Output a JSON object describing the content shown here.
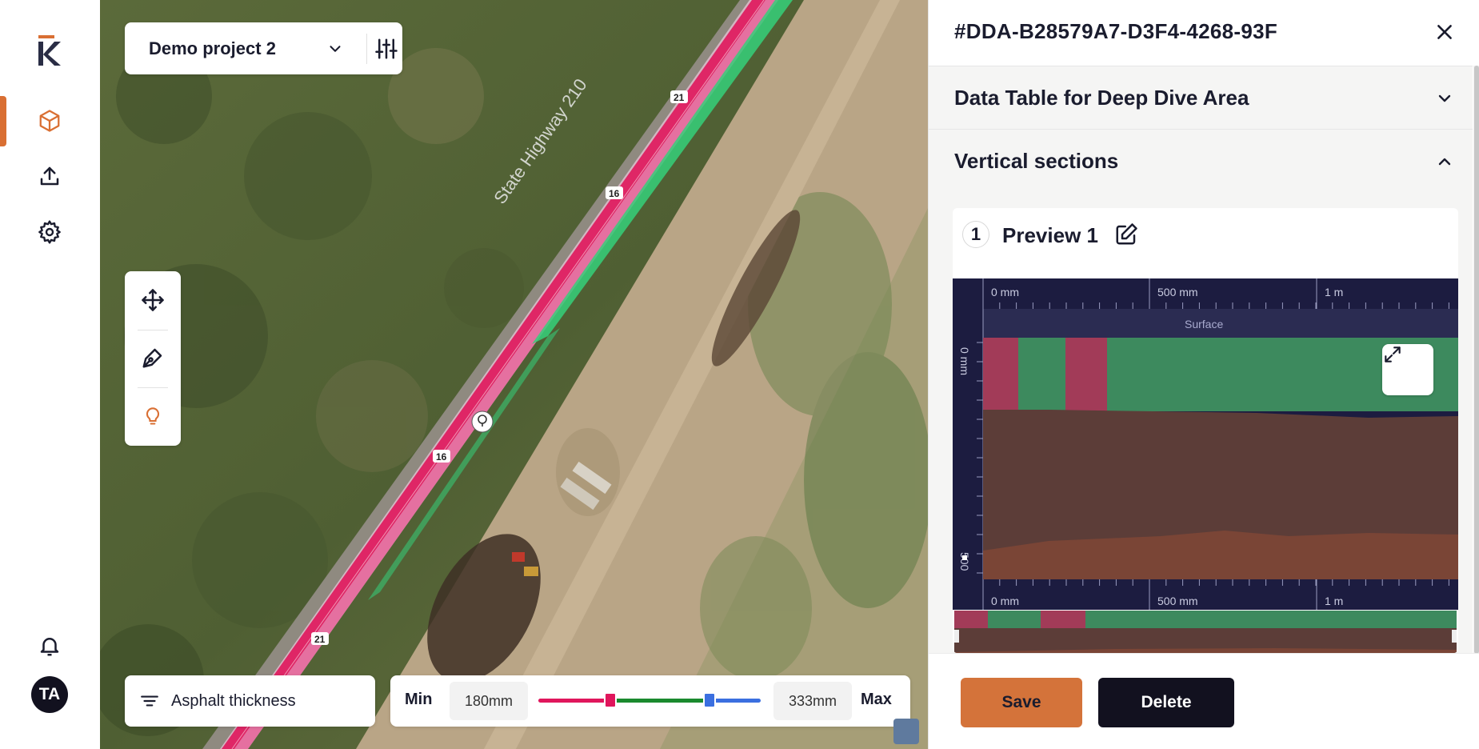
{
  "sidebar": {
    "logo_icon": "kx-logo-icon",
    "items": [
      {
        "icon": "cube-icon",
        "active": true
      },
      {
        "icon": "upload-icon",
        "active": false
      },
      {
        "icon": "gear-icon",
        "active": false
      }
    ],
    "notification_icon": "bell-icon",
    "user_initials": "TA"
  },
  "map": {
    "project_name": "Demo project 2",
    "layer_label": "Asphalt thickness",
    "range": {
      "min_label": "Min",
      "max_label": "Max",
      "min_value": "180mm",
      "max_value": "333mm",
      "colors": {
        "low": "#e0165c",
        "mid": "#1a8a2e",
        "high": "#3b6fe0"
      }
    },
    "road_labels": [
      "State Highway 210",
      "21",
      "16",
      "16",
      "21"
    ]
  },
  "panel": {
    "id_title": "#DDA-B28579A7-D3F4-4268-93F",
    "accordions": [
      {
        "title": "Data Table for Deep Dive Area",
        "expanded": false
      },
      {
        "title": "Vertical sections",
        "expanded": true
      }
    ],
    "preview": {
      "number": "1",
      "name": "Preview 1",
      "top_ticks": [
        "0 mm",
        "500 mm",
        "1 m"
      ],
      "bottom_ticks": [
        "0 mm",
        "500 mm",
        "1 m"
      ],
      "side_ticks": [
        "0 mm",
        "500"
      ],
      "surface_label": "Surface",
      "colors": {
        "asphalt_green": "#3d8a5e",
        "asphalt_red": "#a23b58",
        "base": "#5c3d38",
        "subbase": "#7a4536",
        "background": "#1c1c40"
      }
    },
    "buttons": {
      "save": "Save",
      "delete": "Delete"
    }
  }
}
